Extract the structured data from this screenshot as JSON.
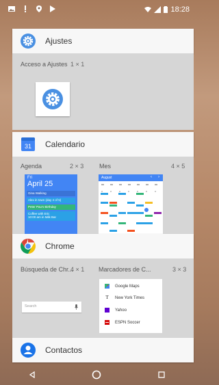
{
  "status_bar": {
    "time": "18:28"
  },
  "apps": [
    {
      "name": "Ajustes",
      "widgets": [
        {
          "label": "Acceso a Ajustes",
          "size": "1 × 1"
        }
      ]
    },
    {
      "name": "Calendario",
      "widgets": [
        {
          "label": "Agenda",
          "size": "2 × 3",
          "day": "Fri",
          "date": "April 25",
          "events": [
            "Gina Walking",
            "Alex in town (day 4 of 5)",
            "Peter Pau's Birthday",
            "Coffee with Eric",
            "10:00 am in Milk Bar"
          ]
        },
        {
          "label": "Mes",
          "size": "4 × 5",
          "month": "August"
        }
      ]
    },
    {
      "name": "Chrome",
      "widgets": [
        {
          "label": "Búsqueda de Chr...",
          "size": "4 × 1",
          "search_placeholder": "Search"
        },
        {
          "label": "Marcadores de C...",
          "size": "3 × 3",
          "bookmarks": [
            "Google Maps",
            "New York Times",
            "Yahoo",
            "ESPN Soccer"
          ]
        }
      ]
    },
    {
      "name": "Contactos"
    }
  ],
  "colors": {
    "header_bg": "#f7f7f7",
    "panel_bg": "#d6d6d6",
    "calendar_blue": "#4285f4"
  }
}
